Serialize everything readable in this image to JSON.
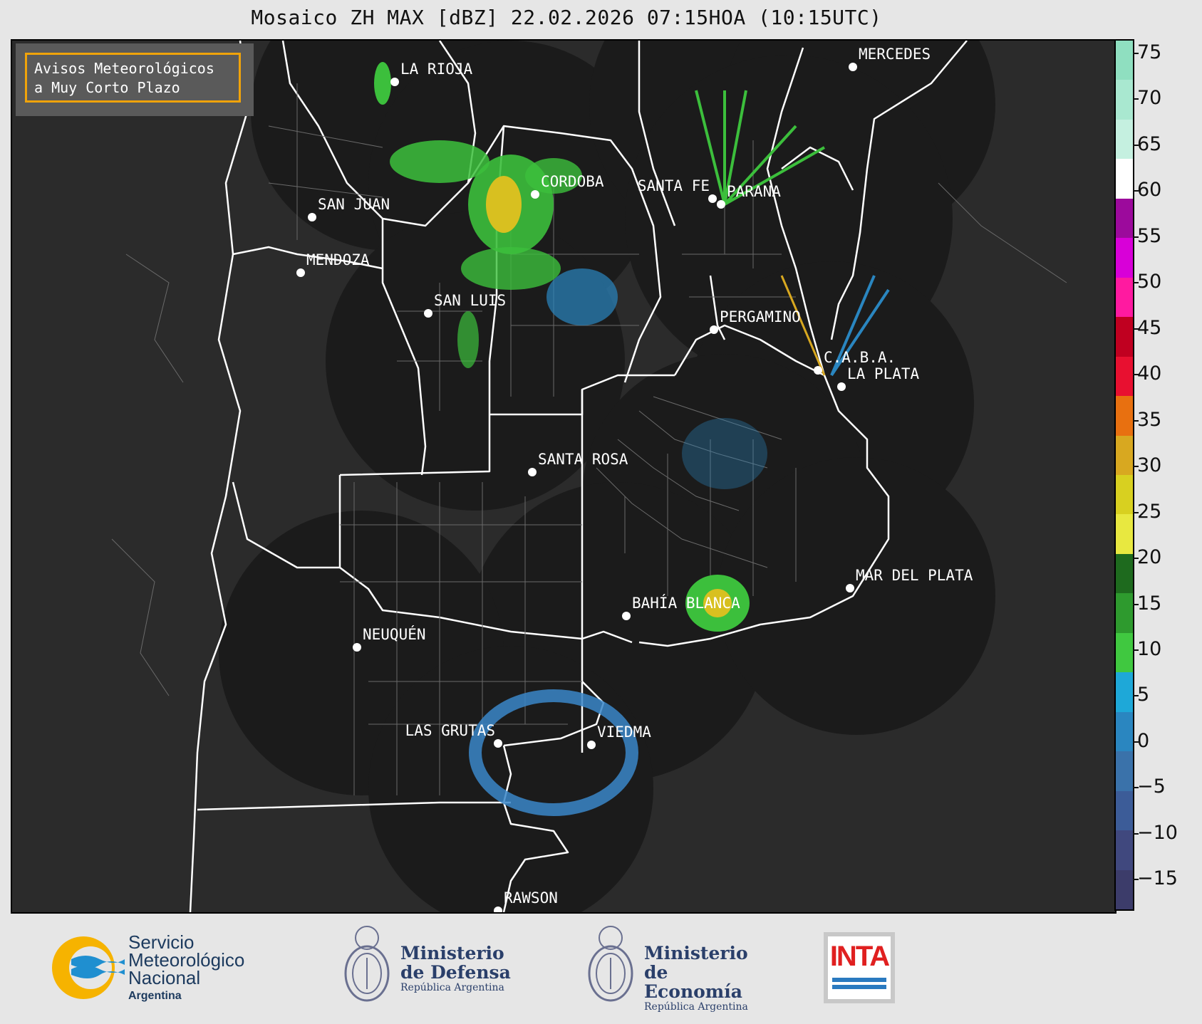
{
  "title": "Mosaico ZH MAX [dBZ] 22.02.2026 07:15HOA (10:15UTC)",
  "notice": {
    "line1": "Avisos Meteorológicos",
    "line2": "a Muy Corto Plazo"
  },
  "colorbar": {
    "unit": "dBZ",
    "range": [
      -20,
      77
    ],
    "ticks": [
      "75",
      "70",
      "65",
      "60",
      "55",
      "50",
      "45",
      "40",
      "35",
      "30",
      "25",
      "20",
      "15",
      "10",
      "5",
      "0",
      "−5",
      "−10",
      "−15"
    ],
    "colors": [
      "#8fdfc0",
      "#a9e8d0",
      "#c5f0e0",
      "#ffffff",
      "#9c0a9c",
      "#d800d8",
      "#ff1aa0",
      "#c00020",
      "#e81030",
      "#e87010",
      "#d8a820",
      "#d8d020",
      "#e8e840",
      "#1e6a1e",
      "#2e9a2e",
      "#40c840",
      "#1ea8d8",
      "#2a86c0",
      "#3a72aa",
      "#3c5c98",
      "#40487e",
      "#3c3c6a"
    ]
  },
  "cities": [
    {
      "name": "LA RIOJA"
    },
    {
      "name": "SAN JUAN"
    },
    {
      "name": "CORDOBA"
    },
    {
      "name": "SANTA FE"
    },
    {
      "name": "PARANA"
    },
    {
      "name": "MERCEDES"
    },
    {
      "name": "MENDOZA"
    },
    {
      "name": "SAN LUIS"
    },
    {
      "name": "PERGAMINO"
    },
    {
      "name": "C.A.B.A."
    },
    {
      "name": "LA PLATA"
    },
    {
      "name": "SANTA ROSA"
    },
    {
      "name": "MAR DEL PLATA"
    },
    {
      "name": "BAHÍA BLANCA"
    },
    {
      "name": "NEUQUÉN"
    },
    {
      "name": "LAS GRUTAS"
    },
    {
      "name": "VIEDMA"
    },
    {
      "name": "RAWSON"
    }
  ],
  "logos": {
    "smn": {
      "line1": "Servicio",
      "line2": "Meteorológico",
      "line3": "Nacional",
      "line4": "Argentina"
    },
    "defensa": {
      "line1": "Ministerio",
      "line2": "de Defensa",
      "line3": "República Argentina"
    },
    "economia": {
      "line1": "Ministerio",
      "line2": "de Economía",
      "line3": "República Argentina"
    },
    "inta": {
      "text": "INTA"
    }
  }
}
